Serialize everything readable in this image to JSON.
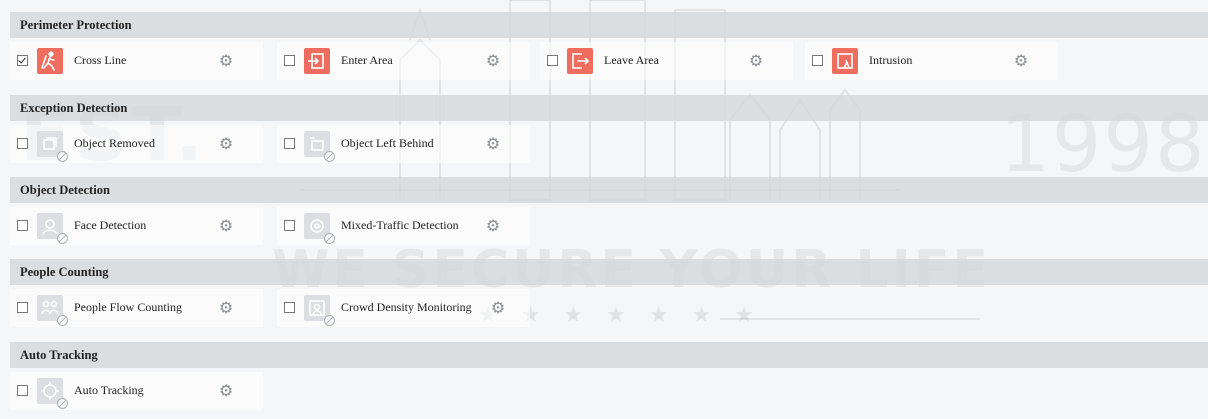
{
  "watermark": {
    "est": "EST.",
    "year": "1998",
    "slogan": "WE SECURE YOUR LIFE",
    "stars": "★ ★ ★ ★ ★ ★ ★"
  },
  "icons": {
    "settings": "gear-icon",
    "disabled": "disabled-icon"
  },
  "colors": {
    "active_icon": "#ef6d5f",
    "inactive_icon": "#dcdee1",
    "section_header": "#d4d8dc"
  },
  "sections": {
    "perimeter": {
      "title": "Perimeter Protection",
      "items": [
        {
          "label": "Cross Line",
          "checked": true,
          "icon": "cross-line-icon"
        },
        {
          "label": "Enter Area",
          "checked": false,
          "icon": "enter-area-icon"
        },
        {
          "label": "Leave Area",
          "checked": false,
          "icon": "leave-area-icon"
        },
        {
          "label": "Intrusion",
          "checked": false,
          "icon": "intrusion-icon"
        }
      ]
    },
    "exception": {
      "title": "Exception Detection",
      "items": [
        {
          "label": "Object Removed",
          "checked": false,
          "icon": "object-removed-icon"
        },
        {
          "label": "Object Left Behind",
          "checked": false,
          "icon": "object-left-behind-icon"
        }
      ]
    },
    "object": {
      "title": "Object Detection",
      "items": [
        {
          "label": "Face Detection",
          "checked": false,
          "icon": "face-detection-icon"
        },
        {
          "label": "Mixed-Traffic Detection",
          "checked": false,
          "icon": "mixed-traffic-icon"
        }
      ]
    },
    "people": {
      "title": "People Counting",
      "items": [
        {
          "label": "People Flow Counting",
          "checked": false,
          "icon": "people-flow-icon"
        },
        {
          "label": "Crowd Density Monitoring",
          "checked": false,
          "icon": "crowd-density-icon"
        }
      ]
    },
    "tracking": {
      "title": "Auto Tracking",
      "items": [
        {
          "label": "Auto Tracking",
          "checked": false,
          "icon": "auto-tracking-icon"
        }
      ]
    }
  }
}
